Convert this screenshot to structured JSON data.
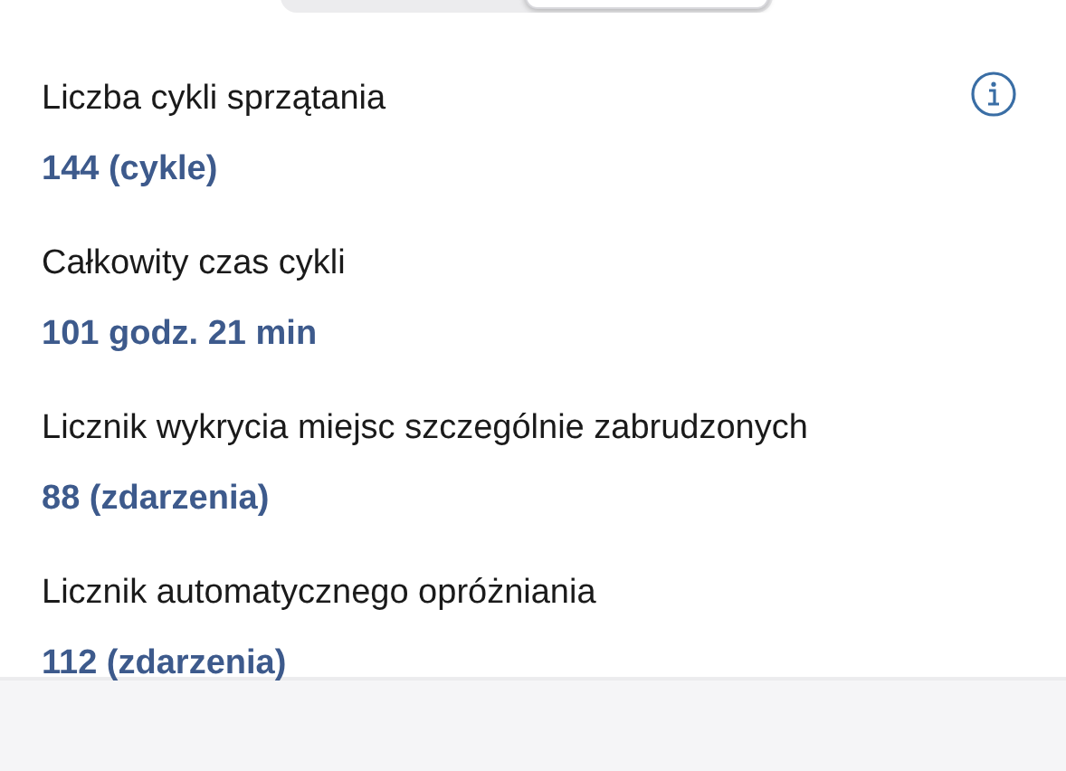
{
  "segmented_control": {
    "segments": [
      {
        "selected": false
      },
      {
        "selected": true
      }
    ]
  },
  "stats": [
    {
      "label": "Liczba cykli sprzątania",
      "value": "144 (cykle)"
    },
    {
      "label": "Całkowity czas cykli",
      "value": "101 godz. 21 min"
    },
    {
      "label": "Licznik wykrycia miejsc szczególnie zabrudzonych",
      "value": "88 (zdarzenia)"
    },
    {
      "label": "Licznik automatycznego opróżniania",
      "value": "112 (zdarzenia)"
    }
  ]
}
